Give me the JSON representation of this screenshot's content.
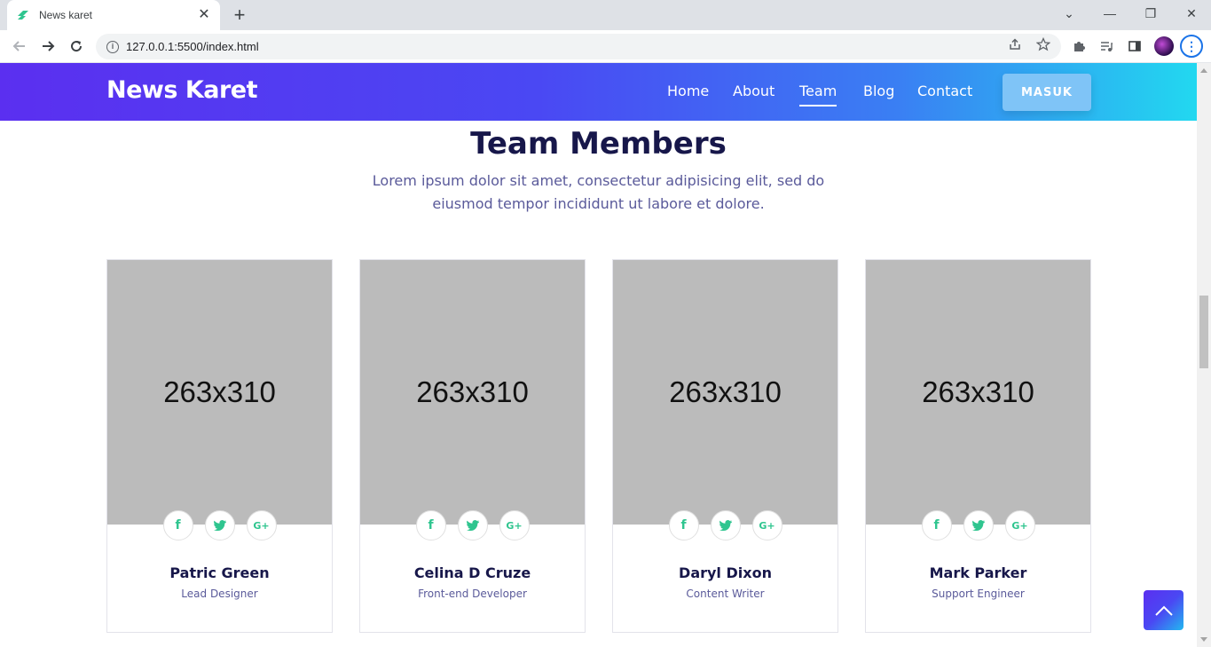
{
  "browser": {
    "tab_title": "News karet",
    "url": "127.0.0.1:5500/index.html",
    "new_tab_label": "+",
    "close_label": "✕",
    "minimize_label": "—",
    "restore_label": "❐",
    "close_window_label": "✕",
    "tabs_dropdown_label": "⌄",
    "menu_label": "⋮"
  },
  "header": {
    "logo": "News Karet",
    "nav": [
      "Home",
      "About",
      "Team",
      "Blog",
      "Contact"
    ],
    "active_nav": "Team",
    "cta": "MASUK"
  },
  "section": {
    "title": "Team Members",
    "subtitle": "Lorem ipsum dolor sit amet, consectetur adipisicing elit, sed do eiusmod tempor incididunt ut labore et dolore."
  },
  "members": [
    {
      "image_label": "263x310",
      "name": "Patric Green",
      "role": "Lead Designer"
    },
    {
      "image_label": "263x310",
      "name": "Celina D Cruze",
      "role": "Front-end Developer"
    },
    {
      "image_label": "263x310",
      "name": "Daryl Dixon",
      "role": "Content Writer"
    },
    {
      "image_label": "263x310",
      "name": "Mark Parker",
      "role": "Support Engineer"
    }
  ],
  "social_icons": [
    "facebook-icon",
    "twitter-icon",
    "google-plus-icon"
  ],
  "social_glyphs": {
    "facebook": "f",
    "google_plus": "G+"
  },
  "colors": {
    "header_gradient_start": "#5b2ff0",
    "header_gradient_end": "#22d8f0",
    "accent_green": "#2fc58f",
    "title_color": "#17174a",
    "cta_bg": "#7fc4f7"
  }
}
